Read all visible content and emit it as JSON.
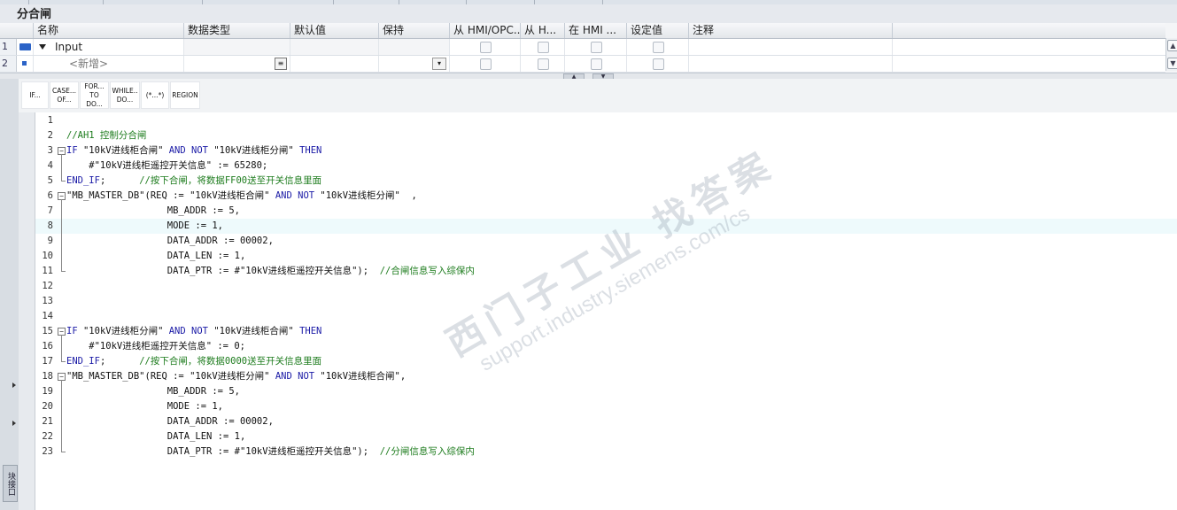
{
  "block": {
    "title": "分合闸"
  },
  "interface": {
    "columns": [
      "名称",
      "数据类型",
      "默认值",
      "保持",
      "从 HMI/OPC...",
      "从 H...",
      "在 HMI ...",
      "设定值",
      "注释"
    ],
    "rows": [
      {
        "num": "1",
        "name": "Input",
        "placeholder": false
      },
      {
        "num": "2",
        "name": "<新增>",
        "placeholder": true
      }
    ]
  },
  "toolbar": {
    "buttons": [
      {
        "label": "IF...",
        "name": "if"
      },
      {
        "label": "CASE... OF...",
        "name": "case-of"
      },
      {
        "label": "FOR... TO DO...",
        "name": "for-to-do"
      },
      {
        "label": "WHILE.. DO...",
        "name": "while-do"
      },
      {
        "label": "(*...*)",
        "name": "comment"
      },
      {
        "label": "REGION",
        "name": "region"
      }
    ]
  },
  "left_panel": {
    "tab_label": "块接口"
  },
  "watermark": {
    "brand": "西门子工业 找答案",
    "url": "support.industry.siemens.com/cs"
  },
  "code": {
    "highlighted_line": 8,
    "lines": [
      {
        "n": "1",
        "t": ""
      },
      {
        "n": "2",
        "t": "//AH1 控制分合闸",
        "kind": "comment"
      },
      {
        "n": "3",
        "t": "IF \"10kV进线柜合闸\" AND NOT \"10kV进线柜分闸\" THEN",
        "fold": "start"
      },
      {
        "n": "4",
        "t": "    #\"10kV进线柜遥控开关信息\" := 65280;"
      },
      {
        "n": "5",
        "t": "END_IF;      //按下合闸，将数据FF00送至开关信息里面",
        "fold": "end"
      },
      {
        "n": "6",
        "t": "\"MB_MASTER_DB\"(REQ := \"10kV进线柜合闸\" AND NOT \"10kV进线柜分闸\"  ,",
        "fold": "start"
      },
      {
        "n": "7",
        "t": "                  MB_ADDR := 5,"
      },
      {
        "n": "8",
        "t": "                  MODE := 1,"
      },
      {
        "n": "9",
        "t": "                  DATA_ADDR := 00002,"
      },
      {
        "n": "10",
        "t": "                  DATA_LEN := 1,"
      },
      {
        "n": "11",
        "t": "                  DATA_PTR := #\"10kV进线柜遥控开关信息\");  //合闸信息写入综保内",
        "fold": "end"
      },
      {
        "n": "12",
        "t": ""
      },
      {
        "n": "13",
        "t": ""
      },
      {
        "n": "14",
        "t": ""
      },
      {
        "n": "15",
        "t": "IF \"10kV进线柜分闸\" AND NOT \"10kV进线柜合闸\" THEN",
        "fold": "start"
      },
      {
        "n": "16",
        "t": "    #\"10kV进线柜遥控开关信息\" := 0;"
      },
      {
        "n": "17",
        "t": "END_IF;      //按下合闸，将数据0000送至开关信息里面",
        "fold": "end"
      },
      {
        "n": "18",
        "t": "\"MB_MASTER_DB\"(REQ := \"10kV进线柜分闸\" AND NOT \"10kV进线柜合闸\",",
        "fold": "start"
      },
      {
        "n": "19",
        "t": "                  MB_ADDR := 5,"
      },
      {
        "n": "20",
        "t": "                  MODE := 1,"
      },
      {
        "n": "21",
        "t": "                  DATA_ADDR := 00002,"
      },
      {
        "n": "22",
        "t": "                  DATA_LEN := 1,"
      },
      {
        "n": "23",
        "t": "                  DATA_PTR := #\"10kV进线柜遥控开关信息\");  //分闸信息写入综保内",
        "fold": "end"
      }
    ]
  }
}
